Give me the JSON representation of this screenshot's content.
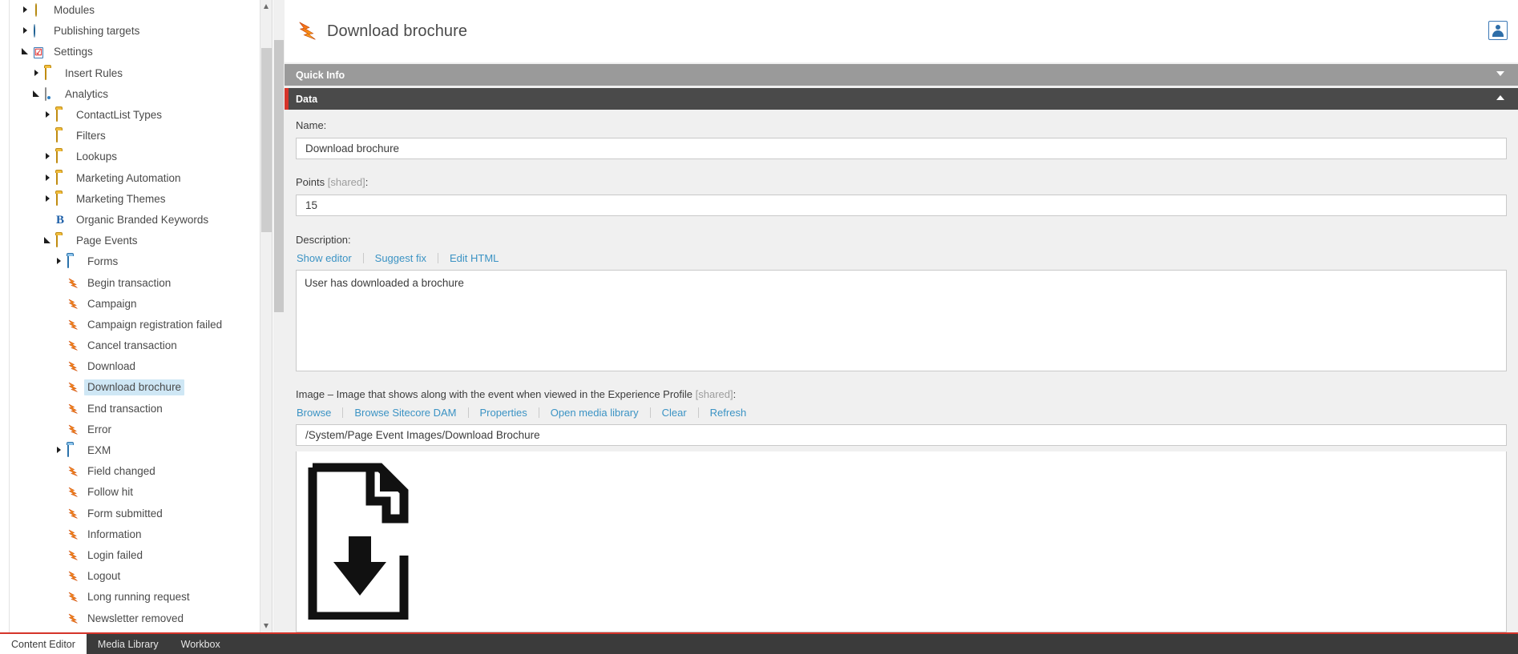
{
  "tree": {
    "items": [
      {
        "label": "Modules",
        "indent": 0,
        "expander": "collapsed",
        "icon": "modules-icon"
      },
      {
        "label": "Publishing targets",
        "indent": 0,
        "expander": "collapsed",
        "icon": "globe-icon"
      },
      {
        "label": "Settings",
        "indent": 0,
        "expander": "expanded",
        "icon": "settings-icon"
      },
      {
        "label": "Insert Rules",
        "indent": 1,
        "expander": "collapsed",
        "icon": "folder-icon"
      },
      {
        "label": "Analytics",
        "indent": 1,
        "expander": "expanded",
        "icon": "analytics-icon"
      },
      {
        "label": "ContactList Types",
        "indent": 2,
        "expander": "collapsed",
        "icon": "folder-icon"
      },
      {
        "label": "Filters",
        "indent": 2,
        "expander": "none",
        "icon": "folder-icon"
      },
      {
        "label": "Lookups",
        "indent": 2,
        "expander": "collapsed",
        "icon": "folder-icon"
      },
      {
        "label": "Marketing Automation",
        "indent": 2,
        "expander": "collapsed",
        "icon": "folder-icon"
      },
      {
        "label": "Marketing Themes",
        "indent": 2,
        "expander": "collapsed",
        "icon": "folder-icon"
      },
      {
        "label": "Organic Branded Keywords",
        "indent": 2,
        "expander": "none",
        "icon": "branded-keyword-icon"
      },
      {
        "label": "Page Events",
        "indent": 2,
        "expander": "expanded",
        "icon": "folder-icon"
      },
      {
        "label": "Forms",
        "indent": 3,
        "expander": "collapsed",
        "icon": "folder-blue-icon"
      },
      {
        "label": "Begin transaction",
        "indent": 3,
        "expander": "none",
        "icon": "page-event-icon"
      },
      {
        "label": "Campaign",
        "indent": 3,
        "expander": "none",
        "icon": "page-event-icon"
      },
      {
        "label": "Campaign registration failed",
        "indent": 3,
        "expander": "none",
        "icon": "page-event-icon"
      },
      {
        "label": "Cancel transaction",
        "indent": 3,
        "expander": "none",
        "icon": "page-event-icon"
      },
      {
        "label": "Download",
        "indent": 3,
        "expander": "none",
        "icon": "page-event-icon"
      },
      {
        "label": "Download brochure",
        "indent": 3,
        "expander": "none",
        "icon": "page-event-icon",
        "selected": true
      },
      {
        "label": "End transaction",
        "indent": 3,
        "expander": "none",
        "icon": "page-event-icon"
      },
      {
        "label": "Error",
        "indent": 3,
        "expander": "none",
        "icon": "page-event-icon"
      },
      {
        "label": "EXM",
        "indent": 3,
        "expander": "collapsed",
        "icon": "folder-blue-icon"
      },
      {
        "label": "Field changed",
        "indent": 3,
        "expander": "none",
        "icon": "page-event-icon"
      },
      {
        "label": "Follow hit",
        "indent": 3,
        "expander": "none",
        "icon": "page-event-icon"
      },
      {
        "label": "Form submitted",
        "indent": 3,
        "expander": "none",
        "icon": "page-event-icon"
      },
      {
        "label": "Information",
        "indent": 3,
        "expander": "none",
        "icon": "page-event-icon"
      },
      {
        "label": "Login failed",
        "indent": 3,
        "expander": "none",
        "icon": "page-event-icon"
      },
      {
        "label": "Logout",
        "indent": 3,
        "expander": "none",
        "icon": "page-event-icon"
      },
      {
        "label": "Long running request",
        "indent": 3,
        "expander": "none",
        "icon": "page-event-icon"
      },
      {
        "label": "Newsletter removed",
        "indent": 3,
        "expander": "none",
        "icon": "page-event-icon"
      }
    ]
  },
  "header": {
    "title": "Download brochure",
    "icon": "page-event-icon",
    "user_icon": "user-icon"
  },
  "sections": {
    "quick_info": {
      "title": "Quick Info",
      "chevron": "chevron-down-icon"
    },
    "data": {
      "title": "Data",
      "chevron": "chevron-up-icon"
    }
  },
  "fields": {
    "name": {
      "label": "Name:",
      "value": "Download brochure"
    },
    "points": {
      "label": "Points",
      "shared": "[shared]",
      "suffix": ":",
      "value": "15"
    },
    "description": {
      "label": "Description:",
      "links": [
        "Show editor",
        "Suggest fix",
        "Edit HTML"
      ],
      "value": "User has downloaded a brochure"
    },
    "image": {
      "label": "Image – Image that shows along with the event when viewed in the Experience Profile",
      "shared": "[shared]",
      "suffix": ":",
      "links": [
        "Browse",
        "Browse Sitecore DAM",
        "Properties",
        "Open media library",
        "Clear",
        "Refresh"
      ],
      "value": "/System/Page Event Images/Download Brochure"
    }
  },
  "tabbar": {
    "tabs": [
      {
        "label": "Content Editor",
        "active": true
      },
      {
        "label": "Media Library",
        "active": false
      },
      {
        "label": "Workbox",
        "active": false
      }
    ]
  },
  "colors": {
    "accent_red": "#d5342a",
    "link_blue": "#3b93c4",
    "data_bar": "#4a4a4a",
    "quickinfo_bar": "#9a9a9a",
    "selection": "#cfe7f5"
  }
}
